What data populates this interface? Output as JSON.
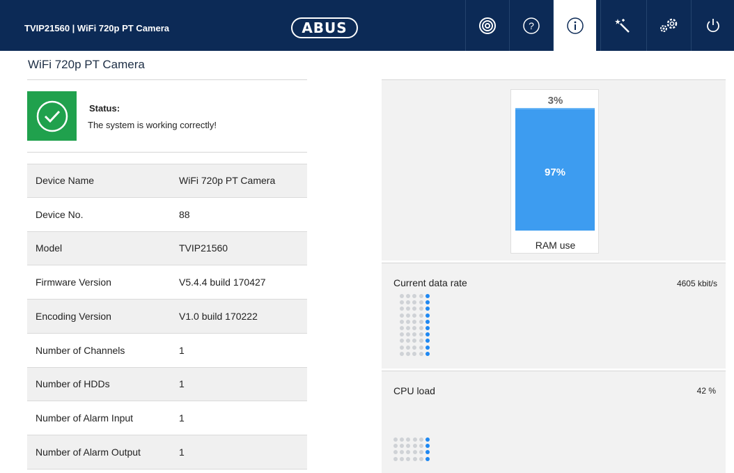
{
  "header": {
    "title": "TVIP21560  |  WiFi 720p PT Camera",
    "logo": "ABUS",
    "nav": [
      {
        "icon": "live-view-icon"
      },
      {
        "icon": "help-icon"
      },
      {
        "icon": "info-icon",
        "active": true
      },
      {
        "icon": "wizard-icon"
      },
      {
        "icon": "settings-icon"
      },
      {
        "icon": "power-icon"
      }
    ]
  },
  "page_title": "WiFi 720p PT Camera",
  "status": {
    "title": "Status:",
    "text": "The system is working correctly!",
    "color": "#20a14d"
  },
  "device_info": [
    {
      "label": "Device Name",
      "value": "WiFi 720p PT Camera"
    },
    {
      "label": "Device No.",
      "value": "88"
    },
    {
      "label": "Model",
      "value": "TVIP21560"
    },
    {
      "label": "Firmware Version",
      "value": "V5.4.4 build 170427"
    },
    {
      "label": "Encoding Version",
      "value": "V1.0 build 170222"
    },
    {
      "label": "Number of Channels",
      "value": "1"
    },
    {
      "label": "Number of HDDs",
      "value": "1"
    },
    {
      "label": "Number of Alarm Input",
      "value": "1"
    },
    {
      "label": "Number of Alarm Output",
      "value": "1"
    }
  ],
  "ram": {
    "free": "3%",
    "used": "97%",
    "used_fraction": 0.97,
    "label": "RAM use",
    "bar_color": "#3d9cf0"
  },
  "data_rate": {
    "label": "Current data rate",
    "value": "4605 kbit/s",
    "dots_active_columns": 1,
    "dot_columns": 5,
    "dot_rows": 10
  },
  "cpu": {
    "label": "CPU load",
    "value": "42 %",
    "dots_active_columns": 1,
    "dot_columns": 6,
    "dot_rows": 4
  },
  "colors": {
    "header_bg": "#0c2a56",
    "accent": "#1e88f2",
    "dot_inactive": "#cfd2d6"
  }
}
